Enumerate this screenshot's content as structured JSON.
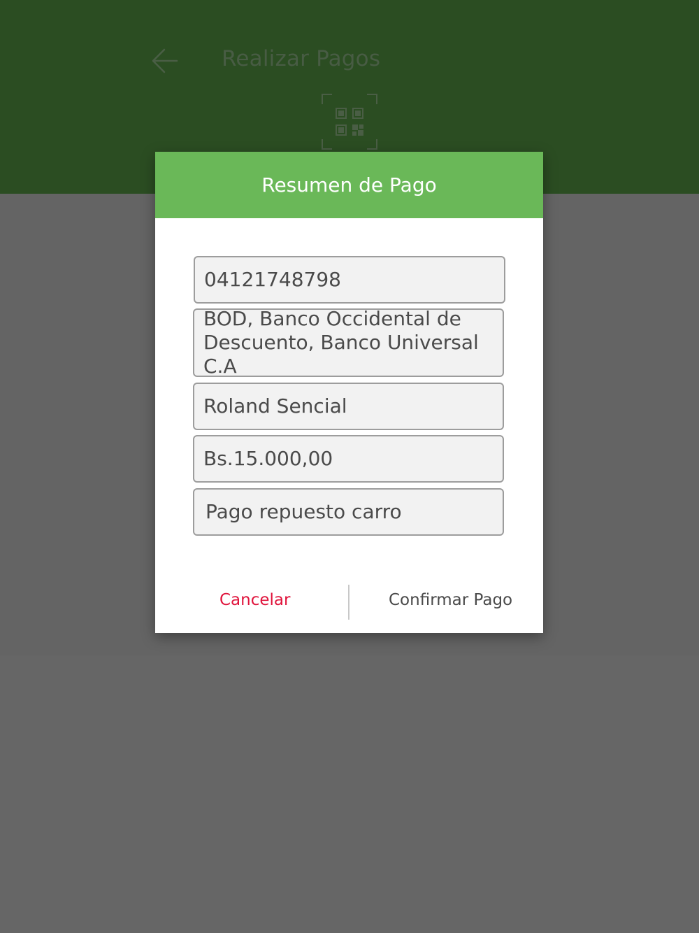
{
  "header": {
    "title": "Realizar Pagos",
    "back_icon": "arrow-left-icon",
    "qr_icon": "qr-scan-icon"
  },
  "dialog": {
    "title": "Resumen de Pago",
    "fields": {
      "phone": "04121748798",
      "bank_line1": "BOD, Banco Occidental de",
      "bank_line2": "Descuento, Banco Universal C.A",
      "name": "Roland Sencial",
      "amount": "Bs.15.000,00",
      "concept": "Pago repuesto carro"
    },
    "cancel_label": "Cancelar",
    "confirm_label": "Confirmar Pago"
  },
  "colors": {
    "header_bg": "#2b4d22",
    "dialog_header_bg": "#6ab858",
    "cancel_text": "#e0143c",
    "overlay": "#666666"
  }
}
